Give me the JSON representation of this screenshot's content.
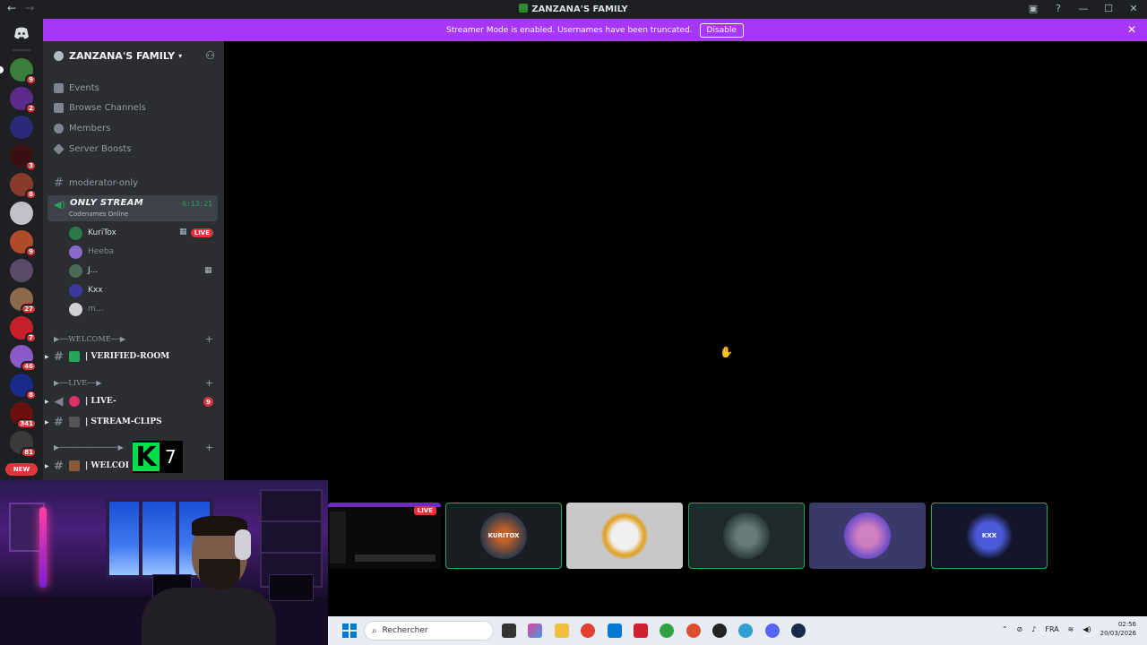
{
  "titlebar": {
    "title": "ZANZANA'S FAMILY",
    "back": "←",
    "forward": "→",
    "help": "?",
    "minimize": "—",
    "maximize": "☐",
    "close": "✕"
  },
  "banner": {
    "message": "Streamer Mode is enabled. Usernames have been truncated.",
    "button": "Disable",
    "close": "✕",
    "color": "#a637f4"
  },
  "guilds": [
    {
      "badge": "9",
      "color": "#3b7d3a",
      "selected": true
    },
    {
      "badge": "2",
      "color": "#5b2a8c"
    },
    {
      "badge": "",
      "color": "#2a2a7a"
    },
    {
      "badge": "3",
      "color": "#3a1010"
    },
    {
      "badge": "8",
      "color": "#8a3a2a"
    },
    {
      "badge": "",
      "color": "#c0c0c8"
    },
    {
      "badge": "9",
      "color": "#b04a2a"
    },
    {
      "badge": "",
      "color": "#5a4a6a"
    },
    {
      "badge": "27",
      "color": "#8a6a4a"
    },
    {
      "badge": "7",
      "color": "#c8202a"
    },
    {
      "badge": "46",
      "color": "#8a5ac8"
    },
    {
      "badge": "8",
      "color": "#1a2a8a"
    },
    {
      "badge": "341",
      "color": "#6a1010"
    },
    {
      "badge": "81",
      "color": "#3a3a3a"
    }
  ],
  "new_label": "NEW",
  "sidebar": {
    "server_name": "ZANZANA'S FAMILY",
    "nav": [
      {
        "label": "Events"
      },
      {
        "label": "Browse Channels"
      },
      {
        "label": "Members"
      },
      {
        "label": "Server Boosts"
      }
    ],
    "text_channel": "moderator-only",
    "voice": {
      "name": "ONLY STREAM",
      "status": "Codenames Online",
      "timer": "6:13:21"
    },
    "voice_users": [
      {
        "name": "KuriTox",
        "live": "LIVE",
        "dim": false,
        "color": "#2a7a4a"
      },
      {
        "name": "Heeba",
        "dim": true,
        "color": "#8a6ac8"
      },
      {
        "name": "J...",
        "dim": false,
        "color": "#4a6a5a"
      },
      {
        "name": "Kxx",
        "dim": false,
        "color": "#3a3a9a"
      },
      {
        "name": "m...",
        "dim": true,
        "color": "#d0d0d0"
      }
    ],
    "categories": [
      {
        "label": "▶──WELCOME──▶"
      },
      {
        "label": "▶──LIVE──▶"
      },
      {
        "label": "▶─────────────▶"
      }
    ],
    "channels": [
      {
        "label": "| VERIFIED-ROOM"
      },
      {
        "label": "| LIVE-",
        "mention": "9"
      },
      {
        "label": "| STREAM-CLIPS"
      },
      {
        "label": "| WELCOI"
      }
    ]
  },
  "overlay": {
    "k_letter": "K",
    "k_number": "7"
  },
  "stage": {
    "live_tag": "LIVE",
    "tiles": [
      {
        "kind": "screen"
      },
      {
        "kind": "avatar",
        "label": "KURITOX",
        "border": "#23a55a"
      },
      {
        "kind": "avatar",
        "label": "",
        "border": ""
      },
      {
        "kind": "avatar",
        "label": "",
        "border": "#23a55a"
      },
      {
        "kind": "avatar",
        "label": "",
        "border": ""
      },
      {
        "kind": "avatar",
        "label": "KXX",
        "border": "#23a55a"
      }
    ]
  },
  "taskbar": {
    "search_placeholder": "Rechercher",
    "language": "FRA",
    "time": "02:56",
    "date": "20/03/2026"
  }
}
